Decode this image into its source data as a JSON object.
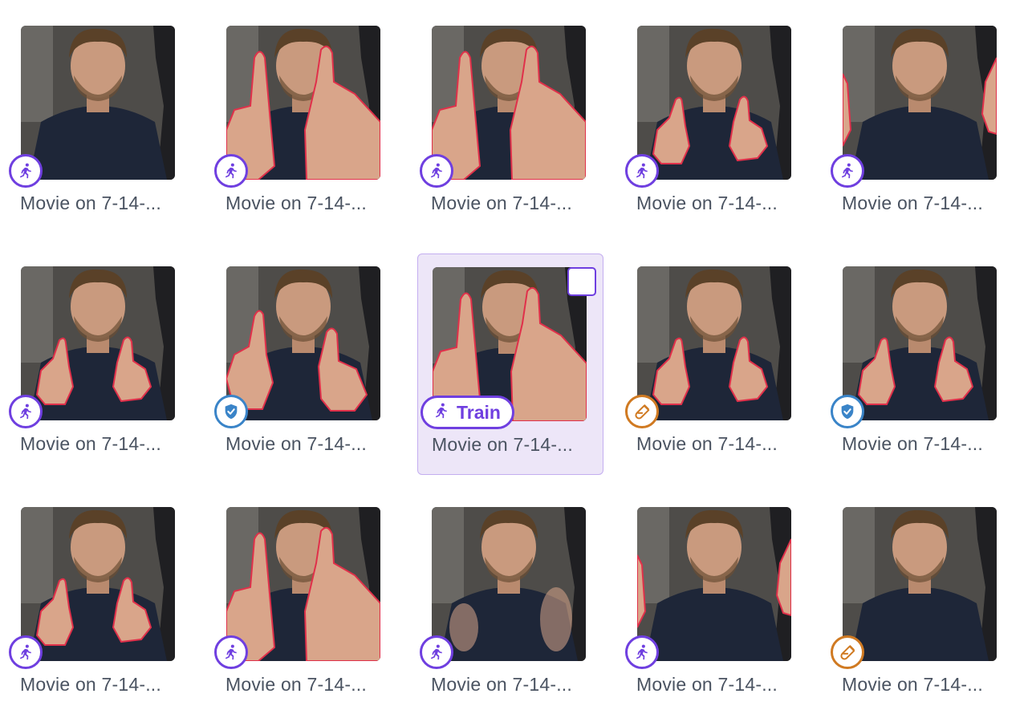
{
  "items": [
    {
      "caption": "Movie on 7-14-...",
      "split": "train",
      "hands": "none",
      "selected": false
    },
    {
      "caption": "Movie on 7-14-...",
      "split": "train",
      "hands": "big",
      "selected": false
    },
    {
      "caption": "Movie on 7-14-...",
      "split": "train",
      "hands": "big",
      "selected": false
    },
    {
      "caption": "Movie on 7-14-...",
      "split": "train",
      "hands": "small",
      "selected": false
    },
    {
      "caption": "Movie on 7-14-...",
      "split": "train",
      "hands": "edge",
      "selected": false
    },
    {
      "caption": "Movie on 7-14-...",
      "split": "train",
      "hands": "small",
      "selected": false
    },
    {
      "caption": "Movie on 7-14-...",
      "split": "validate",
      "hands": "medium",
      "selected": false
    },
    {
      "caption": "Movie on 7-14-...",
      "split": "train",
      "hands": "big",
      "selected": true,
      "split_label": "Train"
    },
    {
      "caption": "Movie on 7-14-...",
      "split": "test",
      "hands": "small",
      "selected": false
    },
    {
      "caption": "Movie on 7-14-...",
      "split": "validate",
      "hands": "small",
      "selected": false
    },
    {
      "caption": "Movie on 7-14-...",
      "split": "train",
      "hands": "small",
      "selected": false
    },
    {
      "caption": "Movie on 7-14-...",
      "split": "train",
      "hands": "big",
      "selected": false
    },
    {
      "caption": "Movie on 7-14-...",
      "split": "train",
      "hands": "blur",
      "selected": false
    },
    {
      "caption": "Movie on 7-14-...",
      "split": "train",
      "hands": "edge",
      "selected": false
    },
    {
      "caption": "Movie on 7-14-...",
      "split": "test",
      "hands": "none",
      "selected": false
    }
  ],
  "icons": {
    "train": "running-person-icon",
    "validate": "shield-check-icon",
    "test": "test-tube-icon"
  },
  "colors": {
    "train": "#6f3fe0",
    "validate": "#3a84c8",
    "test": "#d07a22",
    "outline": "#e0304a",
    "selected_bg": "#ede6f8"
  }
}
